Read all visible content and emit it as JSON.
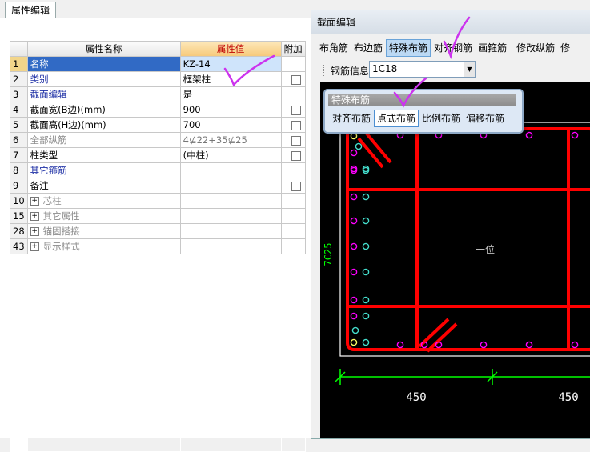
{
  "left_panel": {
    "tab_label": "属性编辑",
    "columns": [
      "属性名称",
      "属性值",
      "附加"
    ],
    "rows": [
      {
        "index": "1",
        "name": "名称",
        "value": "KZ-14",
        "has_check": false,
        "expand": false,
        "style": "selected"
      },
      {
        "index": "2",
        "name": "类别",
        "value": "框架柱",
        "has_check": true,
        "expand": false,
        "style": "blue"
      },
      {
        "index": "3",
        "name": "截面编辑",
        "value": "是",
        "has_check": false,
        "expand": false,
        "style": "blue"
      },
      {
        "index": "4",
        "name": "截面宽(B边)(mm)",
        "value": "900",
        "has_check": true,
        "expand": false,
        "style": "normal"
      },
      {
        "index": "5",
        "name": "截面高(H边)(mm)",
        "value": "700",
        "has_check": true,
        "expand": false,
        "style": "normal"
      },
      {
        "index": "6",
        "name": "全部纵筋",
        "value": "4⊈22+35⊈25",
        "has_check": true,
        "expand": false,
        "style": "grey"
      },
      {
        "index": "7",
        "name": "柱类型",
        "value": "(中柱)",
        "has_check": true,
        "expand": false,
        "style": "normal"
      },
      {
        "index": "8",
        "name": "其它箍筋",
        "value": "",
        "has_check": false,
        "expand": false,
        "style": "blue"
      },
      {
        "index": "9",
        "name": "备注",
        "value": "",
        "has_check": true,
        "expand": false,
        "style": "normal"
      },
      {
        "index": "10",
        "name": "芯柱",
        "value": "",
        "has_check": false,
        "expand": true,
        "style": "grey"
      },
      {
        "index": "15",
        "name": "其它属性",
        "value": "",
        "has_check": false,
        "expand": true,
        "style": "grey"
      },
      {
        "index": "28",
        "name": "锚固搭接",
        "value": "",
        "has_check": false,
        "expand": true,
        "style": "grey"
      },
      {
        "index": "43",
        "name": "显示样式",
        "value": "",
        "has_check": false,
        "expand": true,
        "style": "grey"
      }
    ]
  },
  "section_editor": {
    "title": "截面编辑",
    "toolbar": [
      "布角筋",
      "布边筋",
      "特殊布筋",
      "对齐钢筋",
      "画箍筋",
      "修改纵筋",
      "修"
    ],
    "toolbar_active": 2,
    "rebar_label": "钢筋信息",
    "rebar_value": "1C18",
    "side_label": "7C25",
    "dimension_labels": [
      "450",
      "450"
    ],
    "center_mark": "一位"
  },
  "popup": {
    "title": "特殊布筋",
    "options": [
      "对齐布筋",
      "点式布筋",
      "比例布筋",
      "偏移布筋"
    ],
    "active": 1
  },
  "colors": {
    "rebar_red": "#ff0000",
    "stirrup_white": "#ffffff",
    "dimension_green": "#00ff00",
    "bar_magenta": "#ff00ff",
    "annotation_check": "#cc33ee",
    "selected_row": "#316ac5",
    "header_value": "#c00000"
  }
}
